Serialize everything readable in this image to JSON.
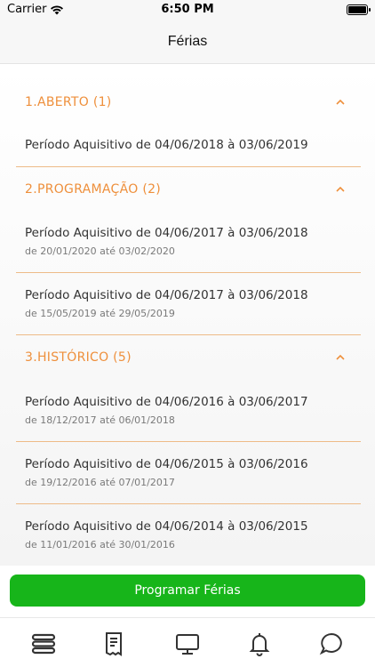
{
  "status_bar": {
    "carrier": "Carrier",
    "time": "6:50 PM"
  },
  "nav": {
    "title": "Férias"
  },
  "sections": [
    {
      "label": "1.ABERTO (1)",
      "items": [
        {
          "title": "Período Aquisitivo de 04/06/2018 à 03/06/2019",
          "subtitle": ""
        }
      ]
    },
    {
      "label": "2.PROGRAMAÇÃO (2)",
      "items": [
        {
          "title": "Período Aquisitivo de 04/06/2017 à 03/06/2018",
          "subtitle": "de 20/01/2020 até 03/02/2020"
        },
        {
          "title": "Período Aquisitivo de 04/06/2017 à 03/06/2018",
          "subtitle": "de 15/05/2019 até 29/05/2019"
        }
      ]
    },
    {
      "label": "3.HISTÓRICO (5)",
      "items": [
        {
          "title": "Período Aquisitivo de 04/06/2016 à 03/06/2017",
          "subtitle": "de 18/12/2017 até 06/01/2018"
        },
        {
          "title": "Período Aquisitivo de 04/06/2015 à 03/06/2016",
          "subtitle": "de 19/12/2016 até 07/01/2017"
        },
        {
          "title": "Período Aquisitivo de 04/06/2014 à 03/06/2015",
          "subtitle": "de 11/01/2016 até 30/01/2016"
        }
      ]
    }
  ],
  "cta": {
    "label": "Programar Férias"
  },
  "colors": {
    "accent": "#ee8f3b",
    "primary_button": "#17b51a"
  },
  "tabs": [
    {
      "icon": "stack-icon"
    },
    {
      "icon": "receipt-icon"
    },
    {
      "icon": "monitor-icon"
    },
    {
      "icon": "bell-icon"
    },
    {
      "icon": "chat-bubble-icon"
    }
  ]
}
